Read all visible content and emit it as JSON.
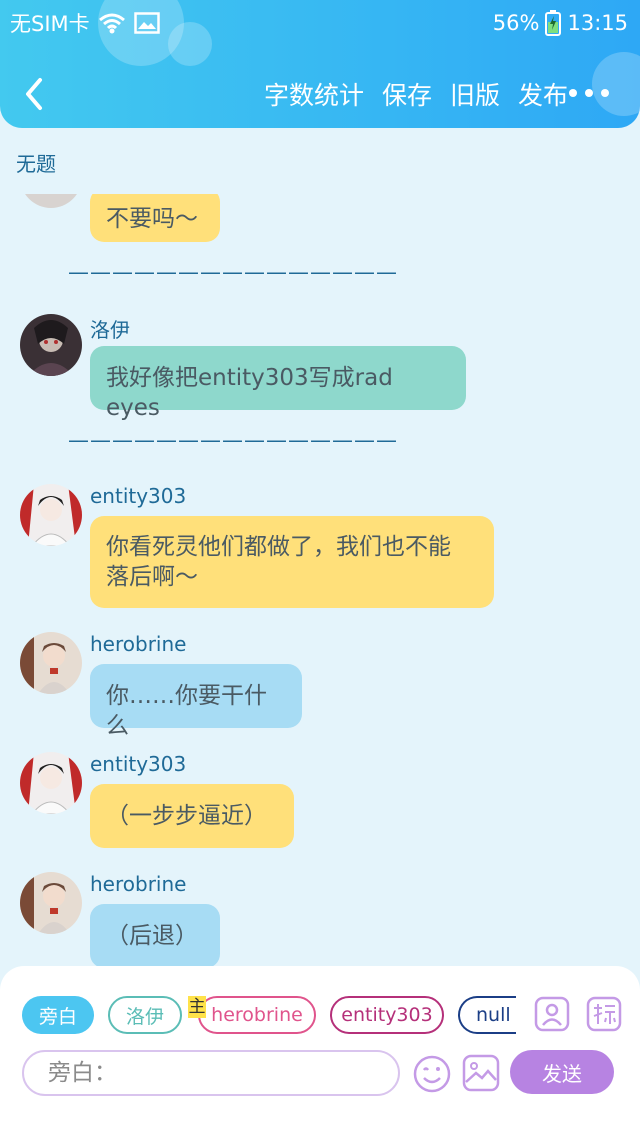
{
  "status_bar": {
    "carrier": "无SIM卡",
    "battery": "56%",
    "time": "13:15"
  },
  "toolbar": {
    "word_count": "字数统计",
    "save": "保存",
    "old_version": "旧版",
    "publish": "发布"
  },
  "doc": {
    "title": "无题"
  },
  "separator": "———————————————",
  "messages": [
    {
      "speaker": "",
      "text": "不要吗～",
      "color": "#ffe07a"
    },
    {
      "speaker": "洛伊",
      "text": "我好像把entity303写成rad eyes",
      "color": "#8ed8cc"
    },
    {
      "speaker": "entity303",
      "line1": "你看死灵他们都做了，我们也不能",
      "line2": "落后啊～",
      "color": "#ffe07a"
    },
    {
      "speaker": "herobrine",
      "text": "你……你要干什么",
      "color": "#a7dcf4"
    },
    {
      "speaker": "entity303",
      "text": "（一步步逼近）",
      "color": "#ffe07a"
    },
    {
      "speaker": "herobrine",
      "text": "（后退）",
      "color": "#a7dcf4"
    }
  ],
  "roles": {
    "narration": "旁白",
    "luoyi": "洛伊",
    "herobrine": "herobrine",
    "entity303": "entity303",
    "null": "null",
    "main_badge": "主"
  },
  "input": {
    "placeholder": "旁白："
  },
  "send_label": "发送",
  "colors": {
    "header": "#36b6f3",
    "narration_chip": "#4cc6f1",
    "luoyi_chip": "#5bbdb6",
    "herobrine_chip": "#e0548c",
    "entity_chip": "#b5307a",
    "null_chip": "#1b3e86",
    "send": "#b783e2"
  }
}
